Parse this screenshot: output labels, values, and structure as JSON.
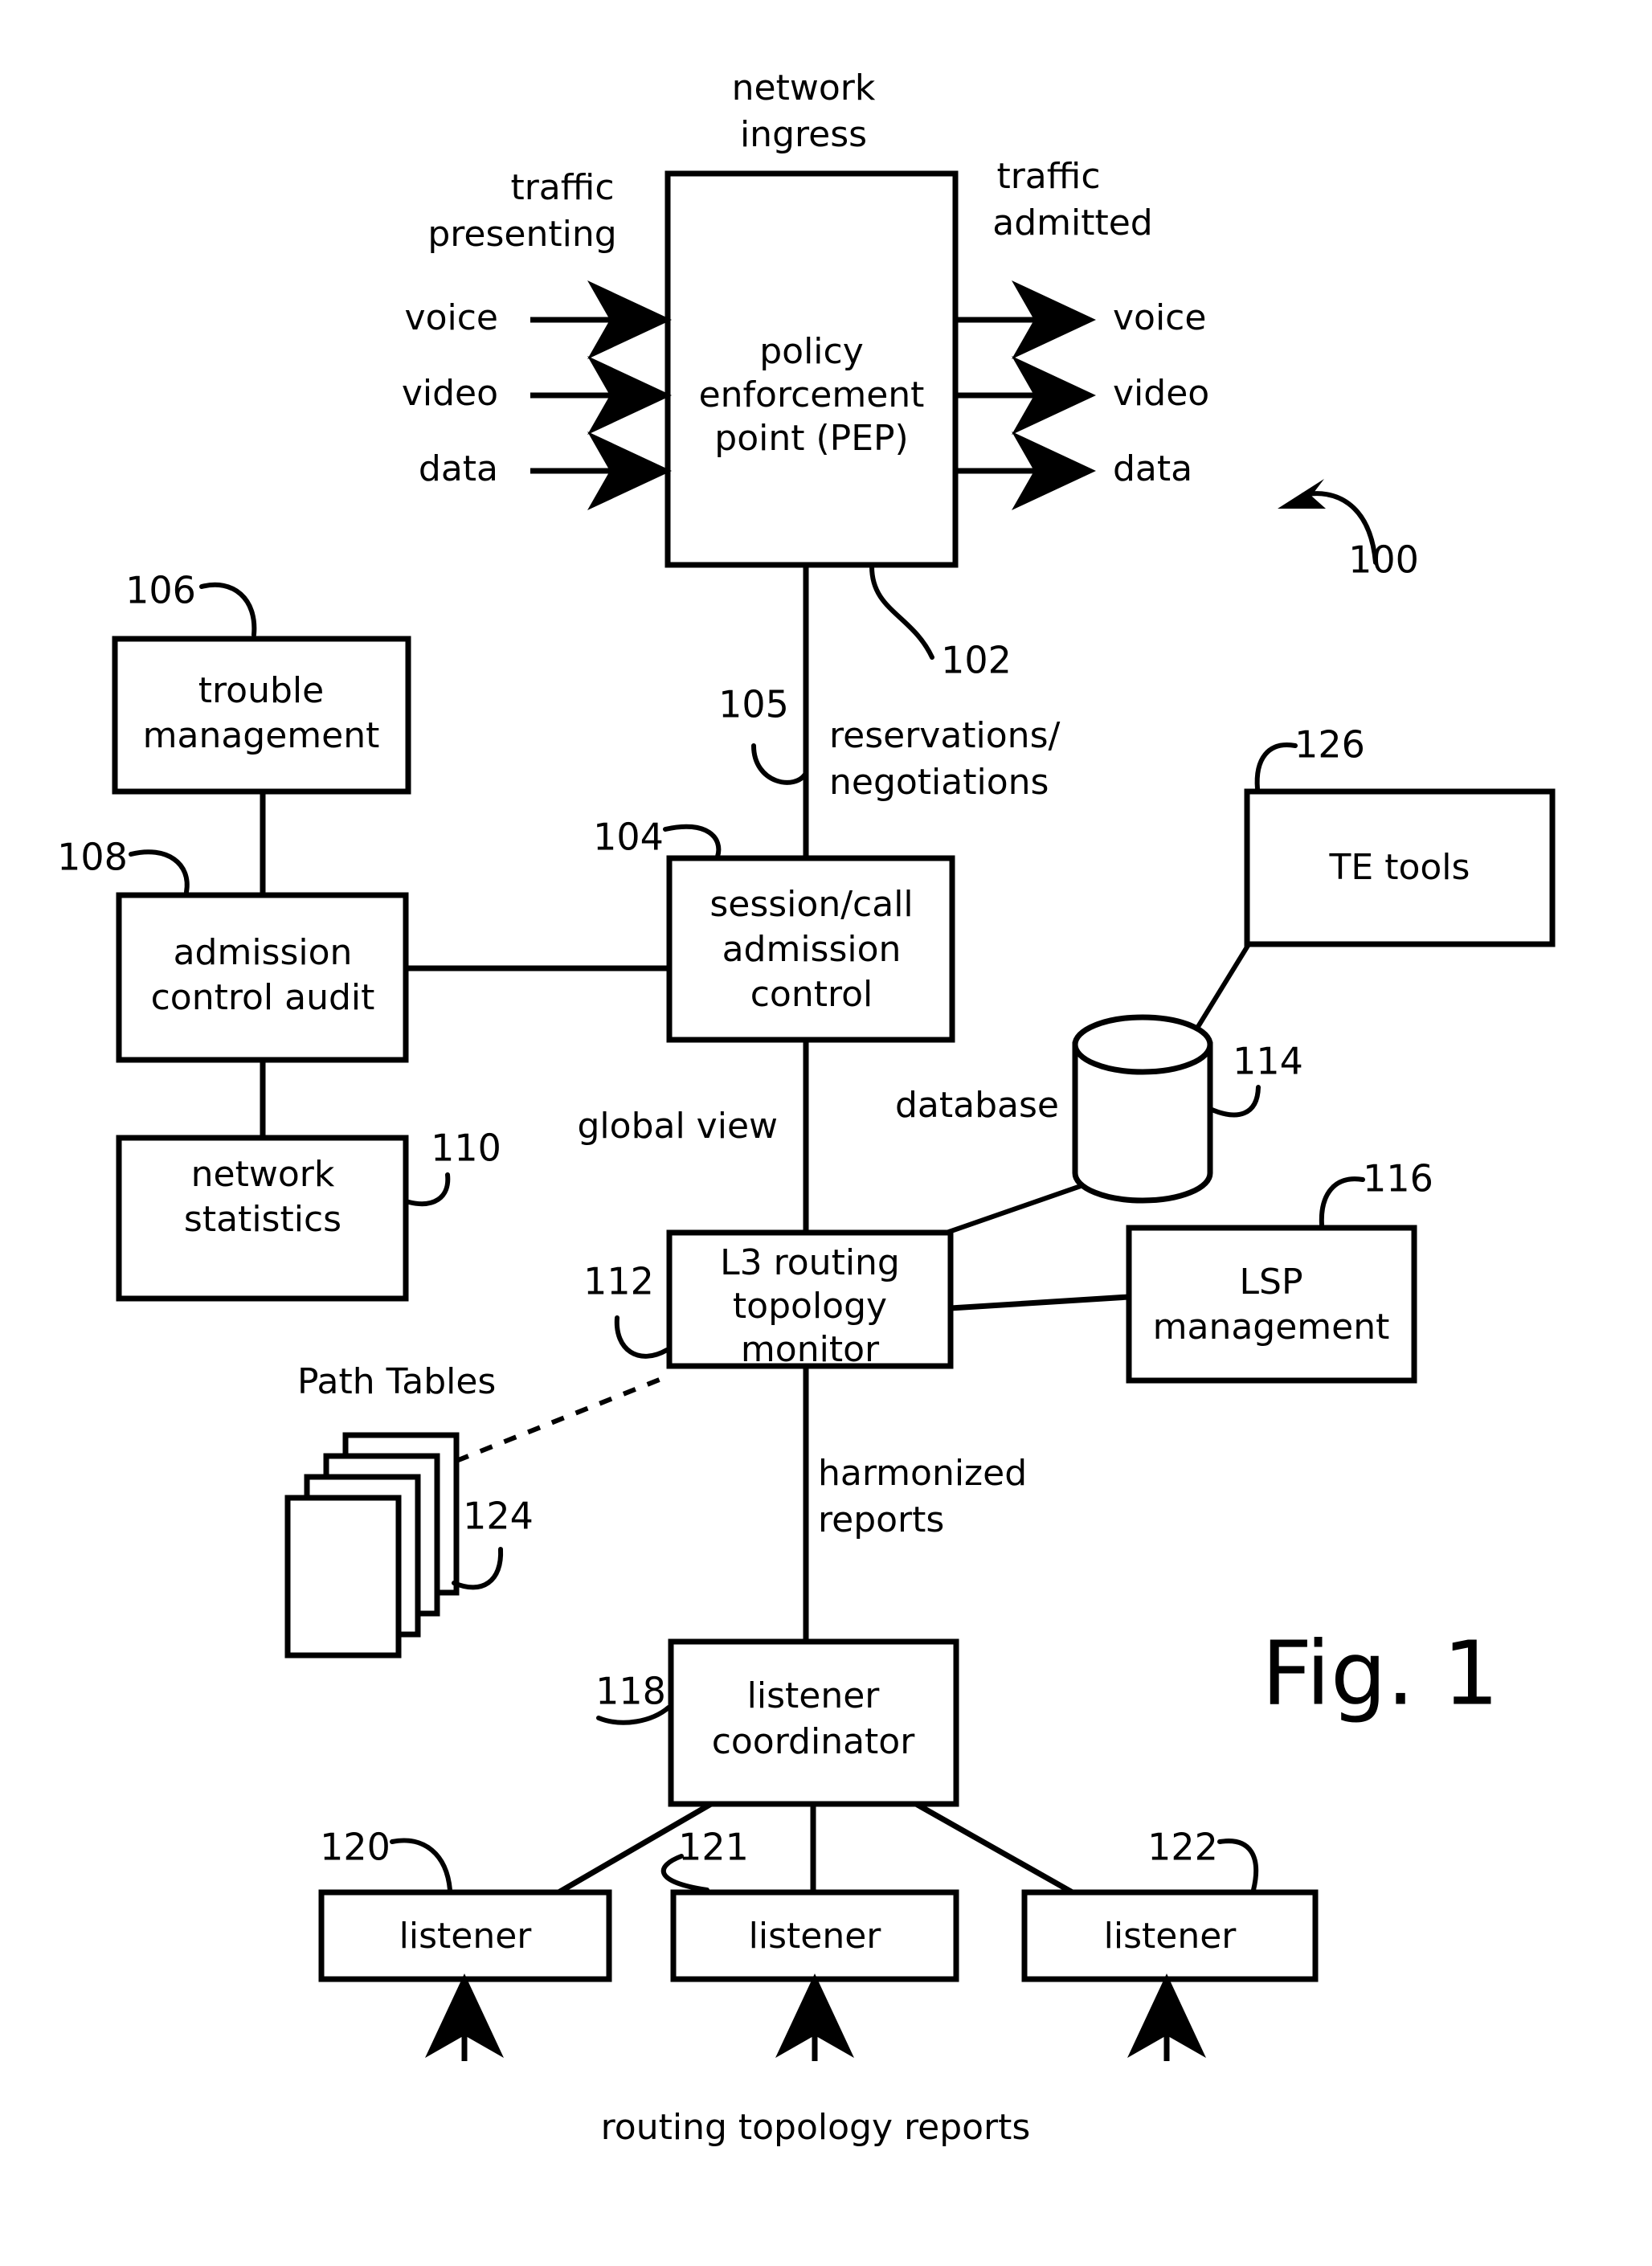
{
  "figure": {
    "label": "Fig. 1",
    "system_ref": "100"
  },
  "nodes": {
    "pep": {
      "ref": "102",
      "line1": "policy",
      "line2": "enforcement",
      "line3": "point (PEP)"
    },
    "cac": {
      "ref": "104",
      "line1": "session/call",
      "line2": "admission",
      "line3": "control"
    },
    "trouble": {
      "ref": "106",
      "line1": "trouble",
      "line2": "management"
    },
    "audit": {
      "ref": "108",
      "line1": "admission",
      "line2": "control audit"
    },
    "netstats": {
      "ref": "110",
      "line1": "network",
      "line2": "statistics"
    },
    "l3mon": {
      "ref": "112",
      "line1": "L3 routing",
      "line2": "topology",
      "line3": "monitor"
    },
    "database": {
      "ref": "114",
      "label": "database"
    },
    "lsp": {
      "ref": "116",
      "line1": "LSP",
      "line2": "management"
    },
    "coordinator": {
      "ref": "118",
      "line1": "listener",
      "line2": "coordinator"
    },
    "listener_left": {
      "ref": "120",
      "label": "listener"
    },
    "listener_mid": {
      "ref": "121",
      "label": "listener"
    },
    "listener_right": {
      "ref": "122",
      "label": "listener"
    },
    "path_tables": {
      "ref": "124",
      "label": "Path Tables"
    },
    "te_tools": {
      "ref": "126",
      "label": "TE tools"
    }
  },
  "labels": {
    "network_ingress_line1": "network",
    "network_ingress_line2": "ingress",
    "traffic_presenting_line1": "traffic",
    "traffic_presenting_line2": "presenting",
    "traffic_admitted_line1": "traffic",
    "traffic_admitted_line2": "admitted",
    "in_voice": "voice",
    "in_video": "video",
    "in_data": "data",
    "out_voice": "voice",
    "out_video": "video",
    "out_data": "data",
    "reservations_line1": "reservations/",
    "reservations_line2": "negotiations",
    "reservations_ref": "105",
    "global_view": "global view",
    "harmonized_line1": "harmonized",
    "harmonized_line2": "reports",
    "routing_topology_reports": "routing topology reports"
  }
}
